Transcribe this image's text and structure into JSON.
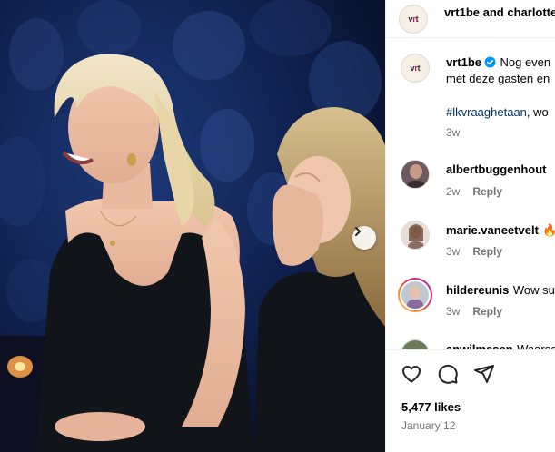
{
  "header": {
    "title": "vrt1be and charlotte"
  },
  "caption": {
    "username": "vrt1be",
    "line1": "Nog even",
    "line2": "met deze gasten en",
    "hashtag": "#lkvraaghetaan",
    "hashtag_suffix": ", wo",
    "time": "3w"
  },
  "comments": [
    {
      "username": "albertbuggenhout",
      "text": "",
      "time": "2w",
      "reply": "Reply"
    },
    {
      "username": "marie.vaneetvelt",
      "text": "🔥",
      "time": "3w",
      "reply": "Reply"
    },
    {
      "username": "hildereunis",
      "text": "Wow su",
      "time": "3w",
      "reply": "Reply"
    },
    {
      "username": "anwilmssen",
      "text": "Waarsc",
      "time": "",
      "reply": ""
    }
  ],
  "footer": {
    "likes": "5,477 likes",
    "date": "January 12"
  },
  "logo": {
    "text_left": "v",
    "text_accent": "r",
    "text_right": "t"
  },
  "colors": {
    "hashtag": "#00376b",
    "meta": "#737373",
    "verified": "#0095f6",
    "border": "#efefef"
  },
  "icons": {
    "like": "heart-icon",
    "comment": "comment-icon",
    "share": "paper-plane-icon",
    "next": "chevron-right-icon",
    "verified": "verified-badge-icon"
  }
}
